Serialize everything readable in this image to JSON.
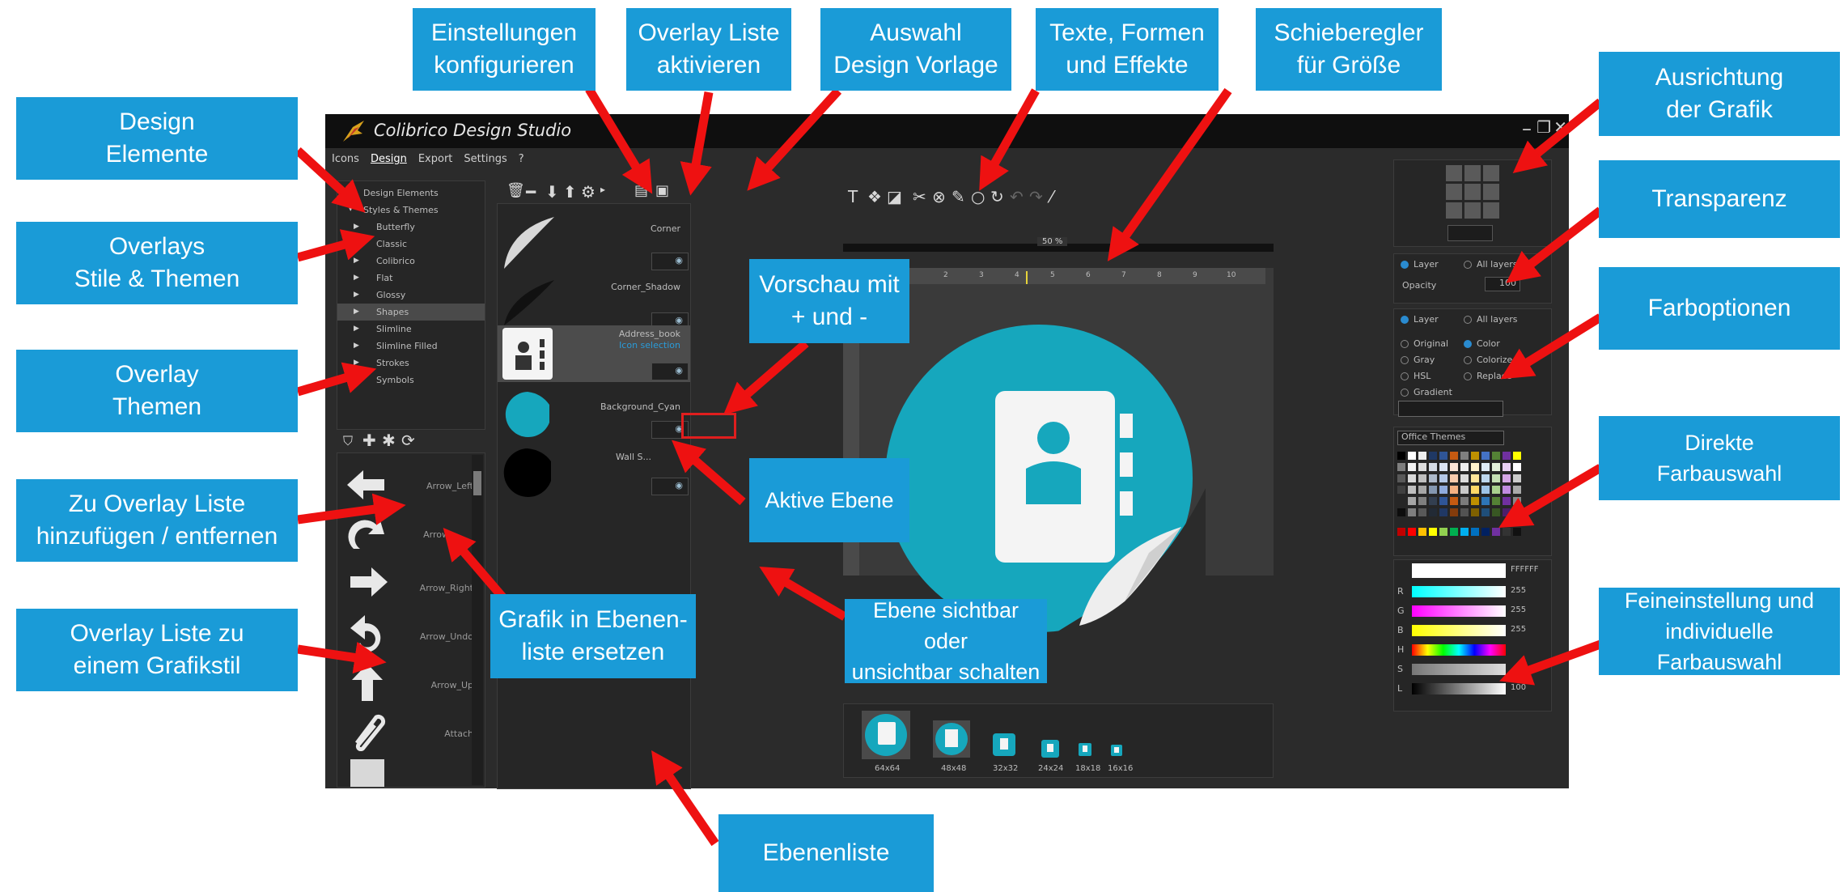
{
  "app": {
    "title": "Colibrico Design Studio",
    "menu": [
      "Icons",
      "Design",
      "Export",
      "Settings",
      "?"
    ],
    "active_menu": "Design"
  },
  "design_tree": {
    "items": [
      {
        "label": "Design Elements",
        "level": 0
      },
      {
        "label": "Styles & Themes",
        "level": 0
      },
      {
        "label": "Butterfly",
        "level": 1
      },
      {
        "label": "Classic",
        "level": 1
      },
      {
        "label": "Colibrico",
        "level": 1
      },
      {
        "label": "Flat",
        "level": 1
      },
      {
        "label": "Glossy",
        "level": 1
      },
      {
        "label": "Shapes",
        "level": 1,
        "selected": true
      },
      {
        "label": "Slimline",
        "level": 1
      },
      {
        "label": "Slimline Filled",
        "level": 1
      },
      {
        "label": "Strokes",
        "level": 1
      },
      {
        "label": "Symbols",
        "level": 1
      }
    ]
  },
  "overlay_list": {
    "items": [
      "Arrow_Left",
      "Arrow",
      "Arrow_Right",
      "Arrow_Undo",
      "Arrow_Up",
      "Attach"
    ]
  },
  "layers": {
    "items": [
      {
        "label": "Corner",
        "sub": ""
      },
      {
        "label": "Corner_Shadow",
        "sub": ""
      },
      {
        "label": "Address_book",
        "sub": "Icon selection"
      },
      {
        "label": "Background_Cyan",
        "sub": ""
      },
      {
        "label": "Wall S...",
        "sub": ""
      }
    ]
  },
  "canvas": {
    "zoom": "50 %",
    "ruler_marks": [
      "2",
      "3",
      "4",
      "5",
      "6",
      "7",
      "8",
      "9",
      "10"
    ],
    "accent_color": "#1aa3b8"
  },
  "previews": [
    "64x64",
    "48x48",
    "32x32",
    "24x24",
    "18x18",
    "16x16"
  ],
  "transparency": {
    "opt_layer": "Layer",
    "opt_all": "All layers",
    "opacity_label": "Opacity",
    "opacity_value": "100"
  },
  "color_options": {
    "opt_layer": "Layer",
    "opt_all": "All layers",
    "modes": [
      "Original",
      "Gray",
      "HSL",
      "Gradient"
    ],
    "modes_right": [
      "Color",
      "Colorize",
      "Replace"
    ],
    "theme_select": "Office Themes"
  },
  "fine_tune": {
    "hex": "FFFFFF",
    "sliders": [
      {
        "label": "R",
        "value": "255"
      },
      {
        "label": "G",
        "value": "255"
      },
      {
        "label": "B",
        "value": "255"
      },
      {
        "label": "H",
        "value": ""
      },
      {
        "label": "S",
        "value": ""
      },
      {
        "label": "L",
        "value": "100"
      }
    ]
  },
  "callouts": {
    "design_elemente": "Design\nElemente",
    "overlays_stile": "Overlays\nStile & Themen",
    "overlay_themen": "Overlay\nThemen",
    "zu_overlay_liste": "Zu Overlay Liste\nhinzufügen / entfernen",
    "overlay_liste_grafikstil": "Overlay  Liste zu\neinem Grafikstil",
    "einstellungen": "Einstellungen\nkonfigurieren",
    "overlay_liste_aktivieren": "Overlay Liste\naktivieren",
    "auswahl_design": "Auswahl\nDesign Vorlage",
    "texte_formen": "Texte, Formen\nund Effekte",
    "schieberegler": "Schieberegler\nfür Größe",
    "ausrichtung": "Ausrichtung\nder Grafik",
    "transparenz": "Transparenz",
    "farboptionen": "Farboptionen",
    "direkte_farbauswahl": "Direkte\nFarbauswahl",
    "feineinstellung": "Feineinstellung und\nindividuelle Farbauswahl",
    "vorschau": "Vorschau mit\n+ und -",
    "aktive_ebene": "Aktive Ebene",
    "grafik_ersetzen": "Grafik in Ebenen-\nliste ersetzen",
    "ebene_sichtbar": "Ebene sichtbar oder\nunsichtbar schalten",
    "ebenenliste": "Ebenenliste"
  }
}
